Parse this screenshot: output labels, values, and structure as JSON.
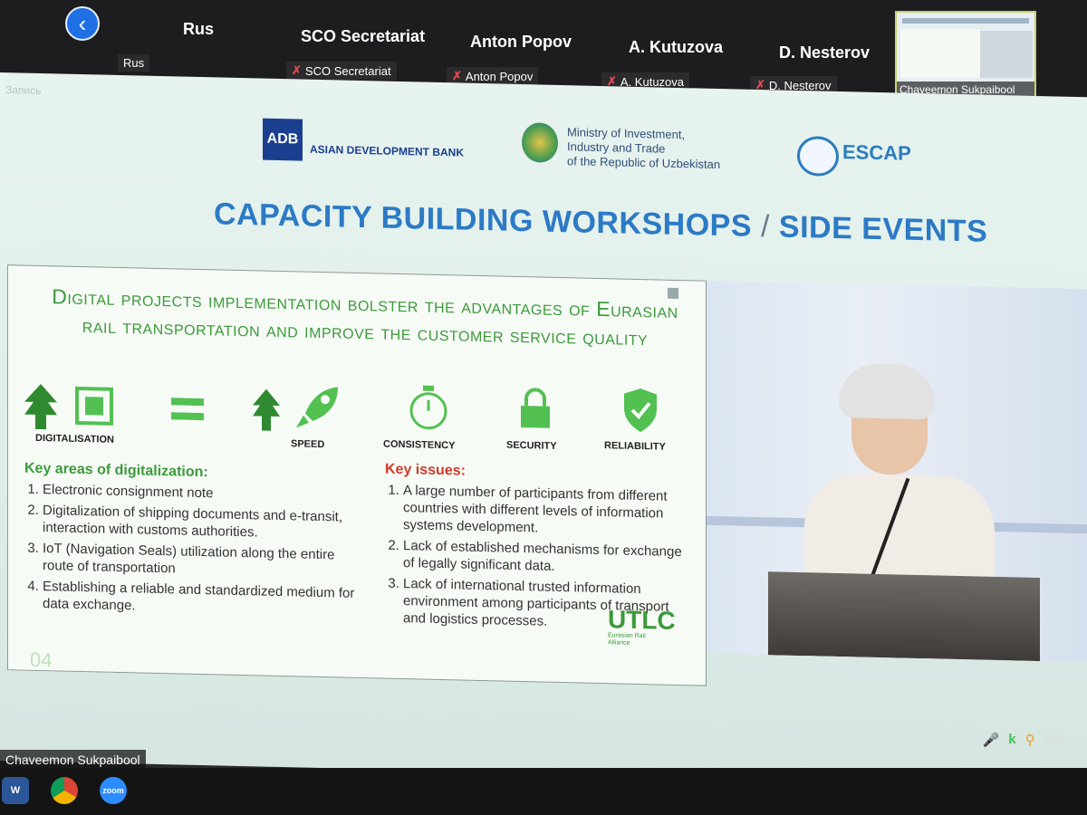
{
  "meeting": {
    "participants": [
      {
        "name": "Rus",
        "tag": "Rus",
        "muted": false
      },
      {
        "name": "SCO Secretariat",
        "tag": "SCO Secretariat",
        "muted": true
      },
      {
        "name": "Anton Popov",
        "tag": "Anton Popov",
        "muted": true
      },
      {
        "name": "A. Kutuzova",
        "tag": "A. Kutuzova",
        "muted": true
      },
      {
        "name": "D. Nesterov",
        "tag": "D. Nesterov",
        "muted": true
      }
    ],
    "active_speaker_thumb": "Chaveemon Sukpaibool",
    "recording_label": "Запись",
    "presenter_name": "Chaveemon Sukpaibool"
  },
  "header_logos": {
    "adb_short": "ADB",
    "adb_full": "ASIAN DEVELOPMENT BANK",
    "ministry_lines": [
      "Ministry of Investment,",
      "Industry and Trade",
      "of the Republic of Uzbekistan"
    ],
    "escap": "ESCAP"
  },
  "banner": {
    "left": "CAPACITY BUILDING WORKSHOPS",
    "sep": "/",
    "right": "SIDE EVENTS"
  },
  "slide": {
    "title": "Digital projects implementation bolster the advantages of Eurasian rail transportation and improve the customer service quality",
    "icon_labels": {
      "digitalisation": "DIGITALISATION",
      "speed": "SPEED",
      "consistency": "CONSISTENCY",
      "security": "SECURITY",
      "reliability": "RELIABILITY"
    },
    "key_areas": {
      "heading": "Key areas of digitalization:",
      "items": [
        "Electronic consignment note",
        "Digitalization of shipping documents and e-transit, interaction with customs authorities.",
        "IoT (Navigation Seals) utilization along the entire route of transportation",
        "Establishing a reliable and standardized medium for data exchange."
      ]
    },
    "key_issues": {
      "heading": "Key issues:",
      "items": [
        "A large number of participants from different countries with different levels of information systems development.",
        "Lack of established mechanisms for exchange of legally significant data.",
        "Lack of international trusted information environment among participants of transport and logistics processes."
      ]
    },
    "brand": "UTLC",
    "brand_sub": "Eurasian Rail Alliance",
    "page": "04"
  },
  "taskbar": {
    "word": "W",
    "zoom": "zoom"
  },
  "colors": {
    "slide_green": "#3b9a3b",
    "banner_blue": "#2c7ac6",
    "zoom_blue": "#1f6fe5"
  }
}
